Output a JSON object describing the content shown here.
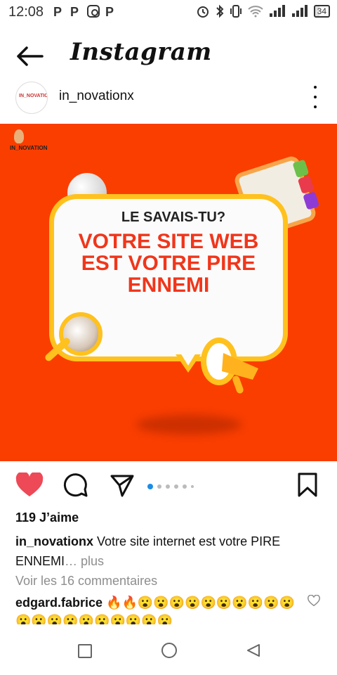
{
  "status_bar": {
    "time": "12:08",
    "battery": "34",
    "app_icons": [
      "p-icon",
      "p-icon",
      "instagram-icon",
      "pinterest-icon"
    ],
    "system_icons": [
      "alarm-icon",
      "bluetooth-icon",
      "vibrate-icon",
      "wifi-icon",
      "signal-icon",
      "signal-icon",
      "battery-icon"
    ]
  },
  "header": {
    "title": "Instagram"
  },
  "post": {
    "username": "in_novationx",
    "image": {
      "brand_text": "IN_NOVATION",
      "kicker": "LE SAVAIS-TU?",
      "headline": "VOTRE SITE WEB EST VOTRE PIRE ENNEMI",
      "background": "#fa3e00",
      "accent": "#ffc11d",
      "text_color": "#f0361b"
    },
    "carousel": {
      "count": 7,
      "active_index": 0
    },
    "likes": "119 J’aime",
    "caption_user": "in_novationx",
    "caption_text": " Votre site internet est votre PIRE ENNEMI",
    "caption_more": "… plus",
    "comments_link": "Voir les 16 commentaires",
    "comment": {
      "user": "edgard.fabrice",
      "text": " 🔥🔥😮😮😮😮😮😮😮😮😮😮😮😮😮😮😮😮😮😮😮😮"
    }
  },
  "colors": {
    "like_red": "#ed4956",
    "link_blue": "#1a8ce8",
    "muted": "#8e8e8e"
  }
}
